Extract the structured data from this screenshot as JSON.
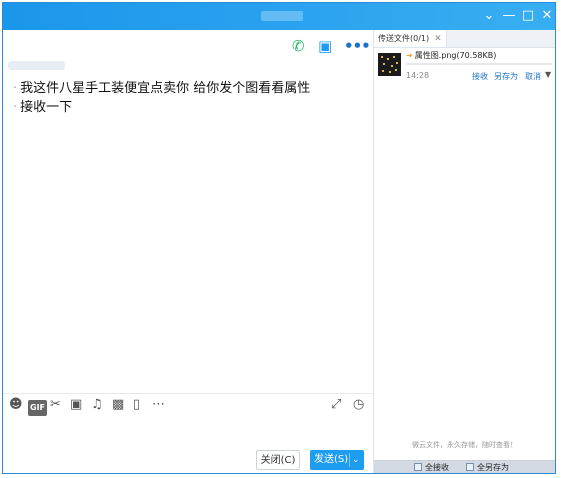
{
  "window": {
    "buttons": {
      "dropdown_icon": "chevron-down",
      "minimize_icon": "minus",
      "maximize_icon": "square",
      "close_icon": "x"
    }
  },
  "chat": {
    "messages": [
      "我这件八星手工装便宜点卖你  给你发个图看看属性",
      "接收一下"
    ],
    "toolbar_icons": [
      "emoji",
      "gif",
      "scissors",
      "folder",
      "music",
      "image",
      "phone-shake",
      "more"
    ],
    "close_label": "关闭(C)",
    "send_label": "发送(S)"
  },
  "side": {
    "tab_label": "传送文件(0/1)",
    "file": {
      "name": "属性图.png(70.58KB)",
      "time": "14:28",
      "accept": "接收",
      "save_as": "另存为",
      "cancel": "取消"
    },
    "note": "微云文件，永久存储，随时查看！",
    "accept_all": "全接收",
    "save_all": "全另存为"
  },
  "colors": {
    "title_bar": "#1a96ea",
    "accent": "#1e9cf0",
    "link": "#1e73c8"
  }
}
